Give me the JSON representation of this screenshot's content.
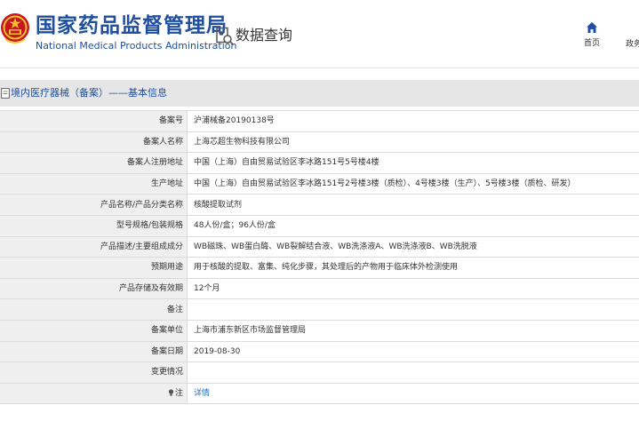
{
  "header": {
    "logo_cn": "国家药品监督管理局",
    "logo_en": "National Medical Products Administration",
    "page_title": "数据查询",
    "nav_home": "首页",
    "nav_more": "政务"
  },
  "section": {
    "title": "境内医疗器械（备案）——基本信息"
  },
  "rows": [
    {
      "label": "备案号",
      "value": "沪浦械备20190138号"
    },
    {
      "label": "备案人名称",
      "value": "上海芯超生物科技有限公司"
    },
    {
      "label": "备案人注册地址",
      "value": "中国（上海）自由贸易试验区李冰路151号5号楼4楼"
    },
    {
      "label": "生产地址",
      "value": "中国（上海）自由贸易试验区李冰路151号2号楼3楼（质检）、4号楼3楼（生产）、5号楼3楼（质检、研发）"
    },
    {
      "label": "产品名称/产品分类名称",
      "value": "核酸提取试剂"
    },
    {
      "label": "型号规格/包装规格",
      "value": "48人份/盒；96人份/盒"
    },
    {
      "label": "产品描述/主要组成成分",
      "value": "WB磁珠、WB蛋白酶、WB裂解结合液、WB洗涤液A、WB洗涤液B、WB洗脱液"
    },
    {
      "label": "预期用途",
      "value": "用于核酸的提取、富集、纯化步骤，其处理后的产物用于临床体外检测使用"
    },
    {
      "label": "产品存储及有效期",
      "value": "12个月"
    },
    {
      "label": "备注",
      "value": ""
    },
    {
      "label": "备案单位",
      "value": "上海市浦东新区市场监督管理局"
    },
    {
      "label": "备案日期",
      "value": "2019-08-30"
    },
    {
      "label": "变更情况",
      "value": ""
    },
    {
      "label": "注",
      "value": "详情"
    }
  ],
  "colors": {
    "brand_blue": "#1f4f9e",
    "link_blue": "#1f6fc2",
    "label_bg": "#efefef",
    "section_bg": "#e6e6e6"
  },
  "icons": {
    "emblem": "national-emblem-icon",
    "search": "search-doc-icon",
    "home": "home-icon",
    "section": "document-icon",
    "note": "bulb-icon"
  }
}
